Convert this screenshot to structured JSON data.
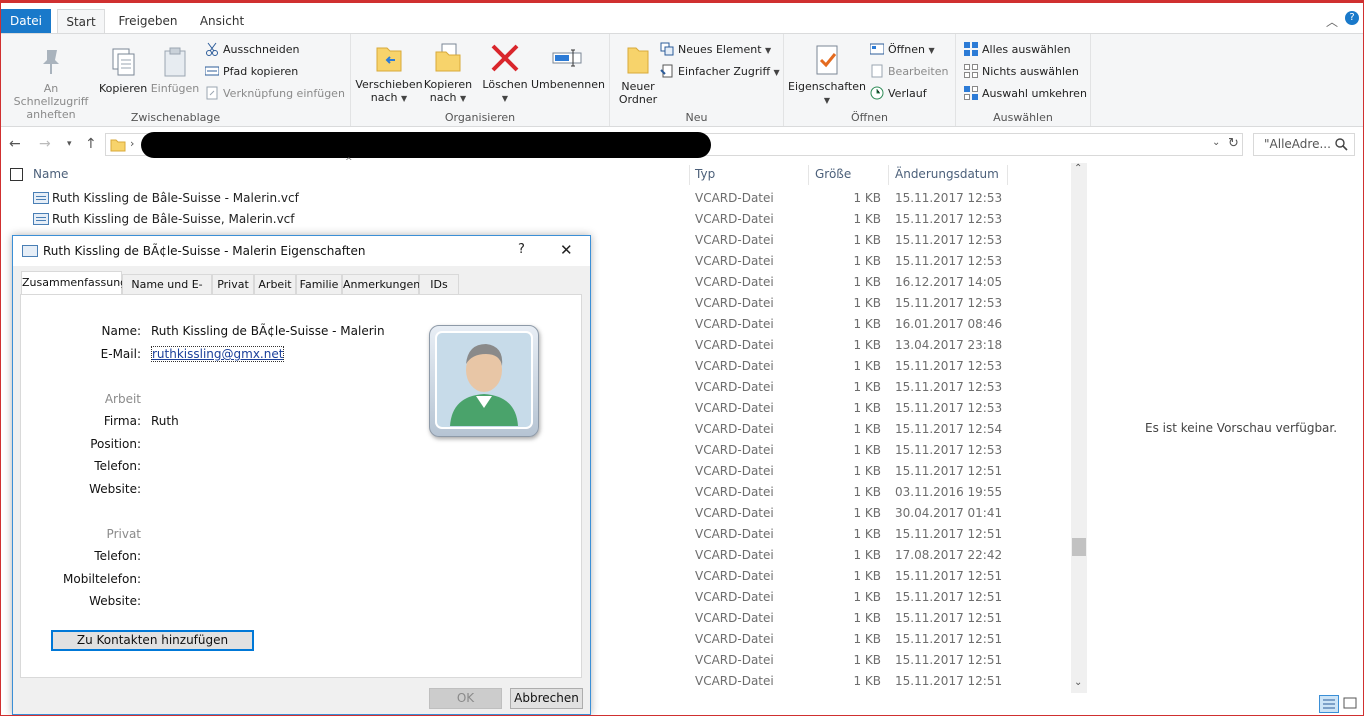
{
  "ribbon": {
    "tabs": [
      {
        "label": "Datei"
      },
      {
        "label": "Start"
      },
      {
        "label": "Freigeben"
      },
      {
        "label": "Ansicht"
      }
    ],
    "groups": {
      "clipboard": {
        "label": "Zwischenablage",
        "pin_label": "An Schnellzugriff anheften",
        "copy_label": "Kopieren",
        "paste_label": "Einfügen",
        "cut_label": "Ausschneiden",
        "copy_path_label": "Pfad kopieren",
        "paste_shortcut_label": "Verknüpfung einfügen"
      },
      "organize": {
        "label": "Organisieren",
        "move_label": "Verschieben nach",
        "copyto_label": "Kopieren nach",
        "delete_label": "Löschen",
        "rename_label": "Umbenennen"
      },
      "new": {
        "label": "Neu",
        "new_folder_label": "Neuer Ordner",
        "new_item_label": "Neues Element",
        "easy_access_label": "Einfacher Zugriff"
      },
      "open": {
        "label": "Öffnen",
        "properties_label": "Eigenschaften",
        "open_label": "Öffnen",
        "edit_label": "Bearbeiten",
        "history_label": "Verlauf"
      },
      "select": {
        "label": "Auswählen",
        "all_label": "Alles auswählen",
        "none_label": "Nichts auswählen",
        "invert_label": "Auswahl umkehren"
      }
    }
  },
  "address": {
    "search_placeholder": "\"AlleAdre..."
  },
  "columns": {
    "name": "Name",
    "type": "Typ",
    "size": "Größe",
    "date": "Änderungsdatum"
  },
  "files": [
    {
      "name": "Ruth Kissling de Bâle-Suisse - Malerin.vcf",
      "type": "VCARD-Datei",
      "size": "1 KB",
      "date": "15.11.2017 12:53"
    },
    {
      "name": "Ruth Kissling de Bâle-Suisse, Malerin.vcf",
      "type": "VCARD-Datei",
      "size": "1 KB",
      "date": "15.11.2017 12:53"
    },
    {
      "name": "",
      "type": "VCARD-Datei",
      "size": "1 KB",
      "date": "15.11.2017 12:53"
    },
    {
      "name": "",
      "type": "VCARD-Datei",
      "size": "1 KB",
      "date": "15.11.2017 12:53"
    },
    {
      "name": "",
      "type": "VCARD-Datei",
      "size": "1 KB",
      "date": "16.12.2017 14:05"
    },
    {
      "name": "",
      "type": "VCARD-Datei",
      "size": "1 KB",
      "date": "15.11.2017 12:53"
    },
    {
      "name": "",
      "type": "VCARD-Datei",
      "size": "1 KB",
      "date": "16.01.2017 08:46"
    },
    {
      "name": "",
      "type": "VCARD-Datei",
      "size": "1 KB",
      "date": "13.04.2017 23:18"
    },
    {
      "name": "",
      "type": "VCARD-Datei",
      "size": "1 KB",
      "date": "15.11.2017 12:53"
    },
    {
      "name": "",
      "type": "VCARD-Datei",
      "size": "1 KB",
      "date": "15.11.2017 12:53"
    },
    {
      "name": "",
      "type": "VCARD-Datei",
      "size": "1 KB",
      "date": "15.11.2017 12:53"
    },
    {
      "name": "",
      "type": "VCARD-Datei",
      "size": "1 KB",
      "date": "15.11.2017 12:54"
    },
    {
      "name": "",
      "type": "VCARD-Datei",
      "size": "1 KB",
      "date": "15.11.2017 12:53"
    },
    {
      "name": "",
      "type": "VCARD-Datei",
      "size": "1 KB",
      "date": "15.11.2017 12:51"
    },
    {
      "name": "",
      "type": "VCARD-Datei",
      "size": "1 KB",
      "date": "03.11.2016 19:55"
    },
    {
      "name": "",
      "type": "VCARD-Datei",
      "size": "1 KB",
      "date": "30.04.2017 01:41"
    },
    {
      "name": "",
      "type": "VCARD-Datei",
      "size": "1 KB",
      "date": "15.11.2017 12:51"
    },
    {
      "name": "",
      "type": "VCARD-Datei",
      "size": "1 KB",
      "date": "17.08.2017 22:42"
    },
    {
      "name": "",
      "type": "VCARD-Datei",
      "size": "1 KB",
      "date": "15.11.2017 12:51"
    },
    {
      "name": "",
      "type": "VCARD-Datei",
      "size": "1 KB",
      "date": "15.11.2017 12:51"
    },
    {
      "name": "",
      "type": "VCARD-Datei",
      "size": "1 KB",
      "date": "15.11.2017 12:51"
    },
    {
      "name": "",
      "type": "VCARD-Datei",
      "size": "1 KB",
      "date": "15.11.2017 12:51"
    },
    {
      "name": "",
      "type": "VCARD-Datei",
      "size": "1 KB",
      "date": "15.11.2017 12:51"
    },
    {
      "name": "",
      "type": "VCARD-Datei",
      "size": "1 KB",
      "date": "15.11.2017 12:51"
    }
  ],
  "preview": {
    "text": "Es ist keine Vorschau verfügbar."
  },
  "dialog": {
    "title": "Ruth Kissling de BÃ¢le-Suisse - Malerin Eigenschaften",
    "help": "?",
    "close": "✕",
    "tabs": [
      {
        "label": "Zusammenfassung"
      },
      {
        "label": "Name und E-Mail"
      },
      {
        "label": "Privat"
      },
      {
        "label": "Arbeit"
      },
      {
        "label": "Familie"
      },
      {
        "label": "Anmerkungen"
      },
      {
        "label": "IDs"
      }
    ],
    "summary": {
      "name_label": "Name:",
      "name_value": "Ruth Kissling de BÃ¢le-Suisse - Malerin",
      "email_label": "E-Mail:",
      "email_value": "ruthkissling@gmx.net",
      "work_section": "Arbeit",
      "company_label": "Firma:",
      "company_value": "Ruth",
      "position_label": "Position:",
      "work_phone_label": "Telefon:",
      "work_website_label": "Website:",
      "private_section": "Privat",
      "home_phone_label": "Telefon:",
      "mobile_label": "Mobiltelefon:",
      "home_website_label": "Website:",
      "add_button": "Zu Kontakten hinzufügen"
    },
    "ok_label": "OK",
    "cancel_label": "Abbrechen"
  }
}
